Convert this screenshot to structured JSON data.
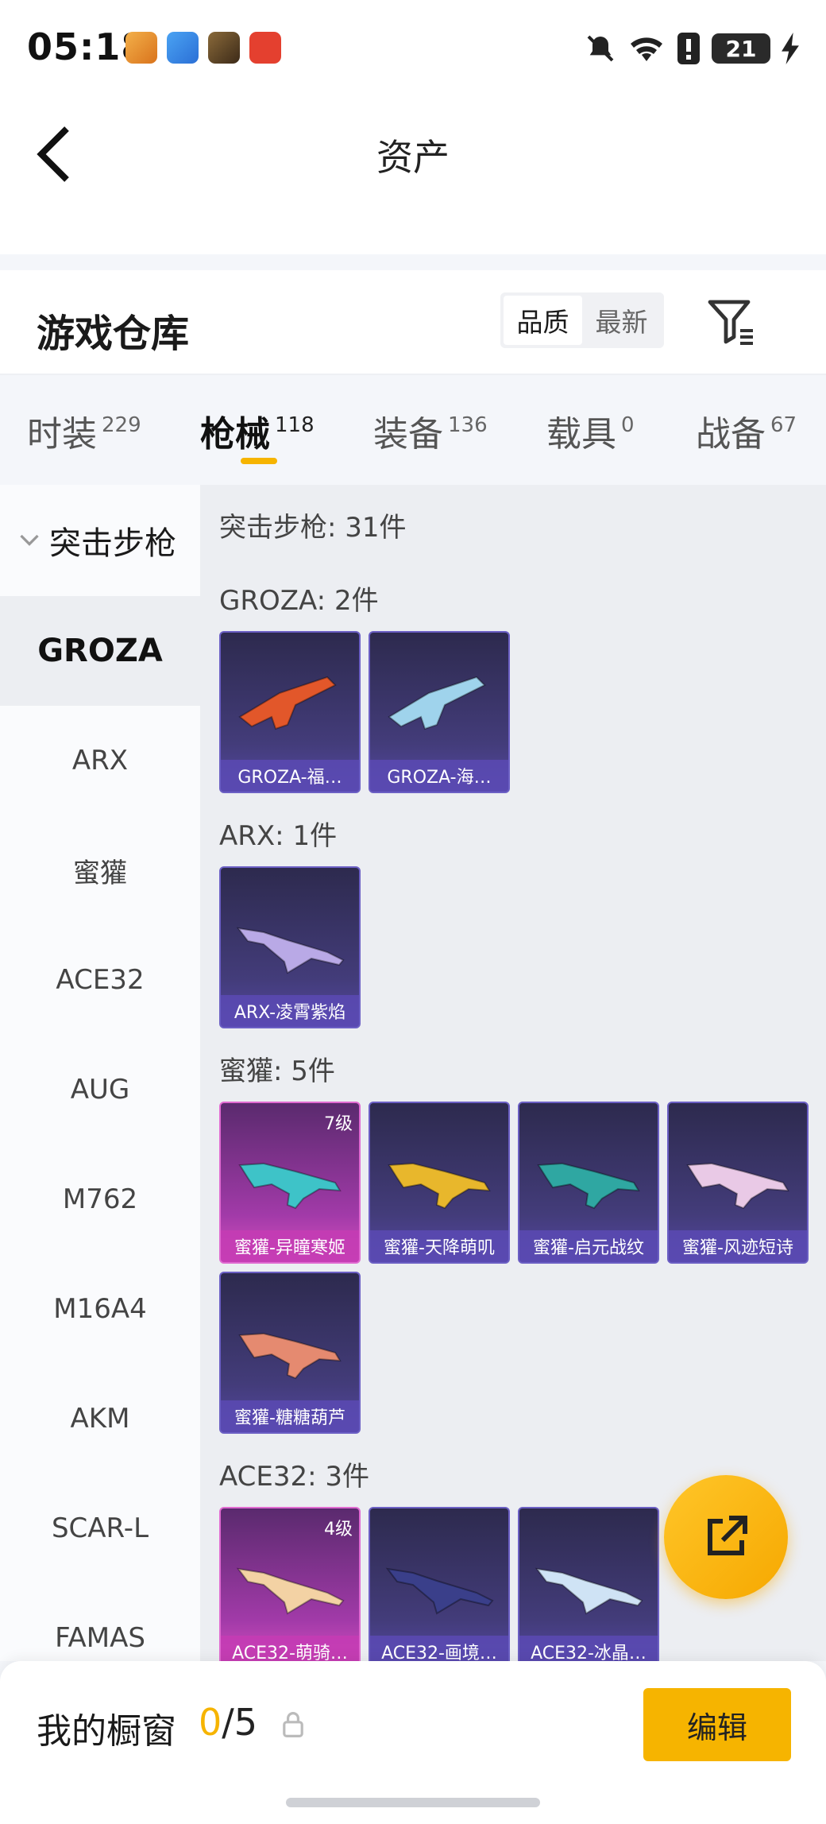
{
  "status_bar": {
    "time": "05:18",
    "battery": "21"
  },
  "header": {
    "title": "资产"
  },
  "warehouse": {
    "title": "游戏仓库",
    "sort": {
      "options": [
        "品质",
        "最新"
      ],
      "selected": "品质"
    }
  },
  "tabs": [
    {
      "label": "时装",
      "count": "229"
    },
    {
      "label": "枪械",
      "count": "118"
    },
    {
      "label": "装备",
      "count": "136"
    },
    {
      "label": "载具",
      "count": "0"
    },
    {
      "label": "战备",
      "count": "67"
    }
  ],
  "active_tab": "枪械",
  "sidebar": {
    "category": "突击步枪",
    "items": [
      "GROZA",
      "ARX",
      "蜜獾",
      "ACE32",
      "AUG",
      "M762",
      "M16A4",
      "AKM",
      "SCAR-L",
      "FAMAS"
    ],
    "selected": "GROZA"
  },
  "content": {
    "category_total": "突击步枪: 31件",
    "sections": [
      {
        "title": "GROZA: 2件",
        "items": [
          {
            "name": "GROZA-福…",
            "rarity": "purple",
            "color": "#e2572a"
          },
          {
            "name": "GROZA-海…",
            "rarity": "purple",
            "color": "#9fd3ec"
          }
        ]
      },
      {
        "title": "ARX: 1件",
        "items": [
          {
            "name": "ARX-凌霄紫焰",
            "rarity": "purple",
            "color": "#b9a9e6"
          }
        ]
      },
      {
        "title": "蜜獾: 5件",
        "items": [
          {
            "name": "蜜獾-异瞳寒姬",
            "rarity": "pink",
            "level": "7级",
            "color": "#3ec3c8"
          },
          {
            "name": "蜜獾-天降萌叽",
            "rarity": "purple",
            "color": "#e8b72c"
          },
          {
            "name": "蜜獾-启元战纹",
            "rarity": "purple",
            "color": "#2fa7a2"
          },
          {
            "name": "蜜獾-风迹短诗",
            "rarity": "purple",
            "color": "#e9c9e6"
          },
          {
            "name": "蜜獾-糖糖葫芦",
            "rarity": "purple",
            "color": "#e58a70"
          }
        ]
      },
      {
        "title": "ACE32: 3件",
        "items": [
          {
            "name": "ACE32-萌骑…",
            "rarity": "pink",
            "level": "4级",
            "color": "#f3d2a4"
          },
          {
            "name": "ACE32-画境…",
            "rarity": "purple",
            "color": "#3a3f8a"
          },
          {
            "name": "ACE32-冰晶…",
            "rarity": "purple",
            "color": "#cfe3f5"
          }
        ]
      }
    ]
  },
  "showcase": {
    "title": "我的橱窗",
    "used": "0",
    "separator": "/",
    "total": "5",
    "edit_label": "编辑"
  },
  "colors": {
    "accent": "#f6b400",
    "purple_card": "#433c7a",
    "pink_card": "#a13aa8"
  }
}
